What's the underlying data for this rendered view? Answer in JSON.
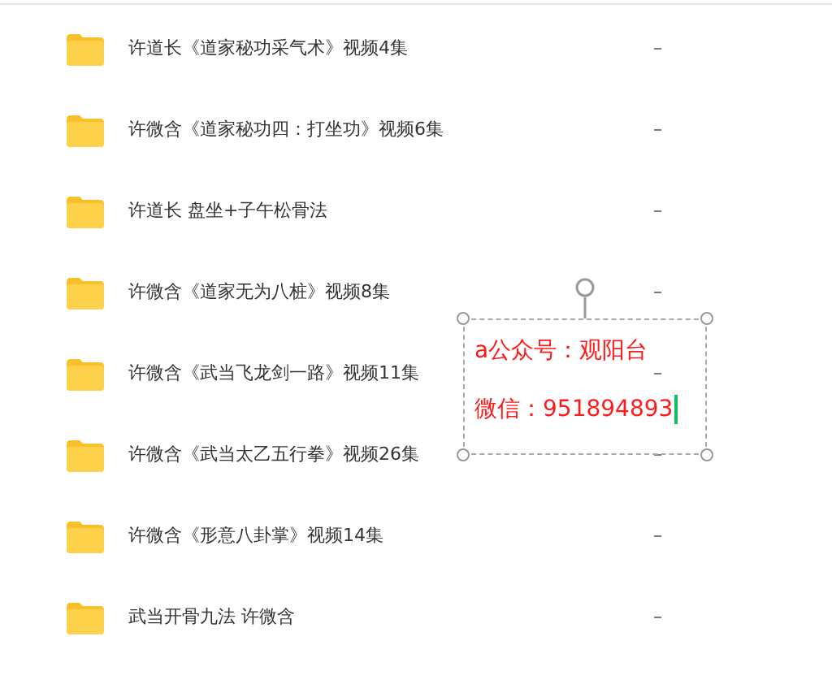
{
  "files": [
    {
      "name": "许道长《道家秘功采气术》视频4集",
      "size": "–"
    },
    {
      "name": "许微含《道家秘功四：打坐功》视频6集",
      "size": "–"
    },
    {
      "name": "许道长 盘坐+子午松骨法",
      "size": "–"
    },
    {
      "name": "许微含《道家无为八桩》视频8集",
      "size": "–"
    },
    {
      "name": "许微含《武当飞龙剑一路》视频11集",
      "size": "–"
    },
    {
      "name": "许微含《武当太乙五行拳》视频26集",
      "size": "–"
    },
    {
      "name": "许微含《形意八卦掌》视频14集",
      "size": "–"
    },
    {
      "name": "武当开骨九法 许微含",
      "size": "–"
    }
  ],
  "text_box": {
    "lines": [
      "a公众号：观阳台",
      "微信：951894893"
    ],
    "editing": true
  }
}
